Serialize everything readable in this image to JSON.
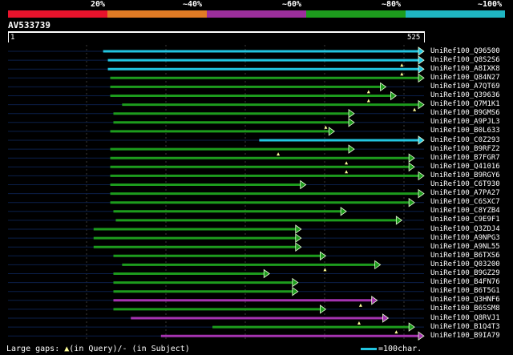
{
  "coverage": {
    "labels": [
      "20%",
      "~40%",
      "~60%",
      "~80%",
      "~100%"
    ],
    "colors": [
      "#e8132c",
      "#e07b25",
      "#9c2f9c",
      "#1d9c1d",
      "#1fb5c2"
    ]
  },
  "query": {
    "id": "AV533739",
    "start_label": "1",
    "end_label": "525",
    "length": 525
  },
  "legend": {
    "large_gaps_prefix": "Large gaps: ",
    "in_query": "(in Query)/- (in Subject)",
    "scale_text": "=100char.",
    "scale_color": "#22c5e0"
  },
  "hits": [
    {
      "name": "UniRef100_Q96500",
      "start": 120,
      "end": 525,
      "color": "#22c5e0",
      "marks": []
    },
    {
      "name": "UniRef100_Q8S2S6",
      "start": 126,
      "end": 525,
      "color": "#22c5e0",
      "marks": [
        497
      ]
    },
    {
      "name": "UniRef100_A8IXK8",
      "start": 126,
      "end": 525,
      "color": "#22c5e0",
      "marks": [
        497
      ]
    },
    {
      "name": "UniRef100_Q84N27",
      "start": 129,
      "end": 525,
      "color": "#1d9c1d",
      "marks": []
    },
    {
      "name": "UniRef100_A7QT69",
      "start": 129,
      "end": 477,
      "color": "#1d9c1d",
      "marks": [
        455
      ]
    },
    {
      "name": "UniRef100_Q39636",
      "start": 129,
      "end": 490,
      "color": "#1d9c1d",
      "marks": [
        455
      ]
    },
    {
      "name": "UniRef100_Q7M1K1",
      "start": 144,
      "end": 525,
      "color": "#1d9c1d",
      "marks": [
        513
      ]
    },
    {
      "name": "UniRef100_B9GMS6",
      "start": 133,
      "end": 437,
      "color": "#1d9c1d",
      "marks": []
    },
    {
      "name": "UniRef100_A9PJL3",
      "start": 133,
      "end": 437,
      "color": "#1d9c1d",
      "marks": [
        401
      ]
    },
    {
      "name": "UniRef100_B0L633",
      "start": 129,
      "end": 412,
      "color": "#1d9c1d",
      "marks": []
    },
    {
      "name": "UniRef100_C0Z293",
      "start": 317,
      "end": 525,
      "color": "#22c5e0",
      "marks": []
    },
    {
      "name": "UniRef100_B9RFZ2",
      "start": 129,
      "end": 437,
      "color": "#1d9c1d",
      "marks": [
        341
      ]
    },
    {
      "name": "UniRef100_B7FGR7",
      "start": 129,
      "end": 513,
      "color": "#1d9c1d",
      "marks": [
        427
      ]
    },
    {
      "name": "UniRef100_Q41016",
      "start": 129,
      "end": 513,
      "color": "#1d9c1d",
      "marks": [
        427
      ]
    },
    {
      "name": "UniRef100_B9RGY6",
      "start": 129,
      "end": 525,
      "color": "#1d9c1d",
      "marks": []
    },
    {
      "name": "UniRef100_C6T930",
      "start": 129,
      "end": 376,
      "color": "#1d9c1d",
      "marks": []
    },
    {
      "name": "UniRef100_A7PA27",
      "start": 129,
      "end": 525,
      "color": "#1d9c1d",
      "marks": []
    },
    {
      "name": "UniRef100_C6SXC7",
      "start": 129,
      "end": 513,
      "color": "#1d9c1d",
      "marks": []
    },
    {
      "name": "UniRef100_C8YZB4",
      "start": 133,
      "end": 427,
      "color": "#1d9c1d",
      "marks": []
    },
    {
      "name": "UniRef100_C9E9F1",
      "start": 136,
      "end": 497,
      "color": "#1d9c1d",
      "marks": []
    },
    {
      "name": "UniRef100_Q3ZDJ4",
      "start": 108,
      "end": 370,
      "color": "#1d9c1d",
      "marks": []
    },
    {
      "name": "UniRef100_A9NPG3",
      "start": 108,
      "end": 370,
      "color": "#1d9c1d",
      "marks": []
    },
    {
      "name": "UniRef100_A9NL55",
      "start": 108,
      "end": 370,
      "color": "#1d9c1d",
      "marks": []
    },
    {
      "name": "UniRef100_B6TXS6",
      "start": 133,
      "end": 401,
      "color": "#1d9c1d",
      "marks": []
    },
    {
      "name": "UniRef100_Q03200",
      "start": 144,
      "end": 470,
      "color": "#1d9c1d",
      "marks": [
        400
      ]
    },
    {
      "name": "UniRef100_B9GZ29",
      "start": 133,
      "end": 330,
      "color": "#1d9c1d",
      "marks": []
    },
    {
      "name": "UniRef100_B4FN76",
      "start": 133,
      "end": 366,
      "color": "#1d9c1d",
      "marks": []
    },
    {
      "name": "UniRef100_B6T5G1",
      "start": 133,
      "end": 366,
      "color": "#1d9c1d",
      "marks": []
    },
    {
      "name": "UniRef100_Q3HNF6",
      "start": 133,
      "end": 466,
      "color": "#a533b0",
      "marks": [
        445
      ]
    },
    {
      "name": "UniRef100_B6SSM8",
      "start": 133,
      "end": 401,
      "color": "#1d9c1d",
      "marks": []
    },
    {
      "name": "UniRef100_Q8RVJ1",
      "start": 155,
      "end": 480,
      "color": "#a533b0",
      "marks": [
        443
      ]
    },
    {
      "name": "UniRef100_B1Q4T3",
      "start": 258,
      "end": 513,
      "color": "#1d9c1d",
      "marks": [
        490
      ]
    },
    {
      "name": "UniRef100_B9IA79",
      "start": 193,
      "end": 525,
      "color": "#a533b0",
      "marks": []
    }
  ]
}
